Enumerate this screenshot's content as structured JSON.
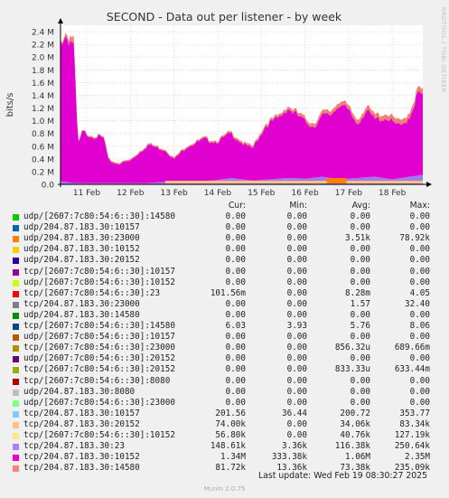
{
  "chart_data": {
    "type": "area",
    "title": "SECOND - Data out per listener - by week",
    "ylabel": "bits/s",
    "ylim": [
      0,
      2500000
    ],
    "y_ticks": [
      {
        "v": 0,
        "label": "0.0"
      },
      {
        "v": 200000,
        "label": "0.2 M"
      },
      {
        "v": 400000,
        "label": "0.4 M"
      },
      {
        "v": 600000,
        "label": "0.6 M"
      },
      {
        "v": 800000,
        "label": "0.8 M"
      },
      {
        "v": 1000000,
        "label": "1.0 M"
      },
      {
        "v": 1200000,
        "label": "1.2 M"
      },
      {
        "v": 1400000,
        "label": "1.4 M"
      },
      {
        "v": 1600000,
        "label": "1.6 M"
      },
      {
        "v": 1800000,
        "label": "1.8 M"
      },
      {
        "v": 2000000,
        "label": "2.0 M"
      },
      {
        "v": 2200000,
        "label": "2.2 M"
      },
      {
        "v": 2400000,
        "label": "2.4 M"
      }
    ],
    "x_ticks": [
      "11 Feb",
      "12 Feb",
      "13 Feb",
      "14 Feb",
      "15 Feb",
      "16 Feb",
      "17 Feb",
      "18 Feb"
    ],
    "x_range_days": [
      0,
      8.3
    ],
    "grid": true,
    "stack_tracks": [
      {
        "name": "tcp/204.87.183.30:23",
        "color": "#a07ce8",
        "points": [
          [
            0,
            0.05
          ],
          [
            0.2,
            0.03
          ],
          [
            0.3,
            0.02
          ],
          [
            1.0,
            0.02
          ],
          [
            1.1,
            0.02
          ],
          [
            2.0,
            0.02
          ],
          [
            2.4,
            0.04
          ],
          [
            3.0,
            0.05
          ],
          [
            3.5,
            0.06
          ],
          [
            3.9,
            0.1
          ],
          [
            4.4,
            0.06
          ],
          [
            4.8,
            0.08
          ],
          [
            5.2,
            0.1
          ],
          [
            5.6,
            0.09
          ],
          [
            6.0,
            0.12
          ],
          [
            6.4,
            0.08
          ],
          [
            6.8,
            0.1
          ],
          [
            7.2,
            0.12
          ],
          [
            7.6,
            0.08
          ],
          [
            8.0,
            0.12
          ],
          [
            8.3,
            0.15
          ]
        ]
      },
      {
        "name": "tcp/204.87.183.30:10152",
        "color": "#e000d0",
        "points": [
          [
            0,
            2.2
          ],
          [
            0.1,
            2.3
          ],
          [
            0.3,
            2.2
          ],
          [
            0.4,
            0.6
          ],
          [
            0.5,
            0.8
          ],
          [
            0.7,
            0.75
          ],
          [
            1.0,
            0.7
          ],
          [
            1.1,
            0.35
          ],
          [
            1.3,
            0.3
          ],
          [
            1.6,
            0.35
          ],
          [
            2.0,
            0.6
          ],
          [
            2.4,
            0.5
          ],
          [
            2.6,
            0.35
          ],
          [
            2.9,
            0.55
          ],
          [
            3.3,
            0.65
          ],
          [
            3.6,
            0.6
          ],
          [
            3.9,
            0.7
          ],
          [
            4.2,
            0.55
          ],
          [
            4.4,
            0.5
          ],
          [
            4.7,
            0.85
          ],
          [
            5.0,
            0.95
          ],
          [
            5.2,
            1.1
          ],
          [
            5.4,
            1.0
          ],
          [
            5.6,
            0.9
          ],
          [
            5.8,
            0.8
          ],
          [
            6.0,
            0.95
          ],
          [
            6.2,
            1.0
          ],
          [
            6.4,
            1.2
          ],
          [
            6.6,
            1.05
          ],
          [
            6.8,
            0.85
          ],
          [
            7.0,
            1.05
          ],
          [
            7.2,
            0.9
          ],
          [
            7.5,
            0.95
          ],
          [
            7.8,
            0.8
          ],
          [
            8.0,
            0.95
          ],
          [
            8.2,
            1.3
          ],
          [
            8.3,
            1.25
          ]
        ]
      },
      {
        "name": "tcp/204.87.183.30:14580",
        "color": "#f08070",
        "points": [
          [
            0,
            0.02
          ],
          [
            0.3,
            0.1
          ],
          [
            0.4,
            0.01
          ],
          [
            1.0,
            0.02
          ],
          [
            2.0,
            0.02
          ],
          [
            3.0,
            0.02
          ],
          [
            4.0,
            0.03
          ],
          [
            5.0,
            0.04
          ],
          [
            6.0,
            0.06
          ],
          [
            7.0,
            0.07
          ],
          [
            8.0,
            0.08
          ],
          [
            8.3,
            0.08
          ]
        ]
      }
    ],
    "bottom_band": {
      "name": "tcp/204.87.183.30:20152",
      "color": "#ffc080"
    }
  },
  "legend": {
    "headers": {
      "cur": "Cur:",
      "min": "Min:",
      "avg": "Avg:",
      "max": "Max:"
    },
    "rows": [
      {
        "name": "udp/[2607:7c80:54:6::30]:14580",
        "color": "#00cc00",
        "cur": "0.00",
        "min": "0.00",
        "avg": "0.00",
        "max": "0.00"
      },
      {
        "name": "udp/204.87.183.30:10157",
        "color": "#0066b3",
        "cur": "0.00",
        "min": "0.00",
        "avg": "0.00",
        "max": "0.00"
      },
      {
        "name": "udp/204.87.183.30:23000",
        "color": "#ff8000",
        "cur": "0.00",
        "min": "0.00",
        "avg": "3.51k",
        "max": "78.92k"
      },
      {
        "name": "udp/204.87.183.30:10152",
        "color": "#ffcc00",
        "cur": "0.00",
        "min": "0.00",
        "avg": "0.00",
        "max": "0.00"
      },
      {
        "name": "udp/204.87.183.30:20152",
        "color": "#330099",
        "cur": "0.00",
        "min": "0.00",
        "avg": "0.00",
        "max": "0.00"
      },
      {
        "name": "tcp/[2607:7c80:54:6::30]:10157",
        "color": "#990099",
        "cur": "0.00",
        "min": "0.00",
        "avg": "0.00",
        "max": "0.00"
      },
      {
        "name": "udp/[2607:7c80:54:6::30]:10152",
        "color": "#ccff00",
        "cur": "0.00",
        "min": "0.00",
        "avg": "0.00",
        "max": "0.00"
      },
      {
        "name": "tcp/[2607:7c80:54:6::30]:23",
        "color": "#ff0000",
        "cur": "101.56m",
        "min": "0.00",
        "avg": "8.28m",
        "max": "4.05"
      },
      {
        "name": "tcp/204.87.183.30:23000",
        "color": "#808080",
        "cur": "0.00",
        "min": "0.00",
        "avg": "1.57",
        "max": "32.40"
      },
      {
        "name": "udp/204.87.183.30:14580",
        "color": "#008f00",
        "cur": "0.00",
        "min": "0.00",
        "avg": "0.00",
        "max": "0.00"
      },
      {
        "name": "tcp/[2607:7c80:54:6::30]:14580",
        "color": "#00487d",
        "cur": "6.03",
        "min": "3.93",
        "avg": "5.76",
        "max": "8.06"
      },
      {
        "name": "udp/[2607:7c80:54:6::30]:10157",
        "color": "#b35a00",
        "cur": "0.00",
        "min": "0.00",
        "avg": "0.00",
        "max": "0.00"
      },
      {
        "name": "tcp/[2607:7c80:54:6::30]:23000",
        "color": "#b38f00",
        "cur": "0.00",
        "min": "0.00",
        "avg": "856.32u",
        "max": "689.66m"
      },
      {
        "name": "udp/[2607:7c80:54:6::30]:20152",
        "color": "#6b006b",
        "cur": "0.00",
        "min": "0.00",
        "avg": "0.00",
        "max": "0.00"
      },
      {
        "name": "tcp/[2607:7c80:54:6::30]:20152",
        "color": "#8fb300",
        "cur": "0.00",
        "min": "0.00",
        "avg": "833.33u",
        "max": "633.44m"
      },
      {
        "name": "tcp/[2607:7c80:54:6::30]:8080",
        "color": "#b30000",
        "cur": "0.00",
        "min": "0.00",
        "avg": "0.00",
        "max": "0.00"
      },
      {
        "name": "udp/204.87.183.30:8080",
        "color": "#bebebe",
        "cur": "0.00",
        "min": "0.00",
        "avg": "0.00",
        "max": "0.00"
      },
      {
        "name": "udp/[2607:7c80:54:6::30]:23000",
        "color": "#80ff80",
        "cur": "0.00",
        "min": "0.00",
        "avg": "0.00",
        "max": "0.00"
      },
      {
        "name": "tcp/204.87.183.30:10157",
        "color": "#80c9ff",
        "cur": "201.56",
        "min": "36.44",
        "avg": "200.72",
        "max": "353.77"
      },
      {
        "name": "tcp/204.87.183.30:20152",
        "color": "#ffc080",
        "cur": "74.00k",
        "min": "0.00",
        "avg": "34.06k",
        "max": "83.34k"
      },
      {
        "name": "tcp/[2607:7c80:54:6::30]:10152",
        "color": "#ffe680",
        "cur": "56.80k",
        "min": "0.00",
        "avg": "40.76k",
        "max": "127.19k"
      },
      {
        "name": "tcp/204.87.183.30:23",
        "color": "#aa80ff",
        "cur": "148.61k",
        "min": "3.36k",
        "avg": "116.38k",
        "max": "250.64k"
      },
      {
        "name": "tcp/204.87.183.30:10152",
        "color": "#ee00cc",
        "cur": "1.34M",
        "min": "333.38k",
        "avg": "1.06M",
        "max": "2.35M"
      },
      {
        "name": "tcp/204.87.183.30:14580",
        "color": "#ff8080",
        "cur": "81.72k",
        "min": "13.36k",
        "avg": "73.38k",
        "max": "235.09k"
      }
    ]
  },
  "footer": {
    "last_update": "Last update:  Wed Feb 19 08:30:27 2025",
    "munin": "Munin 2.0.75",
    "rrdtool": "RRDTOOL / TOBI OETIKER"
  }
}
